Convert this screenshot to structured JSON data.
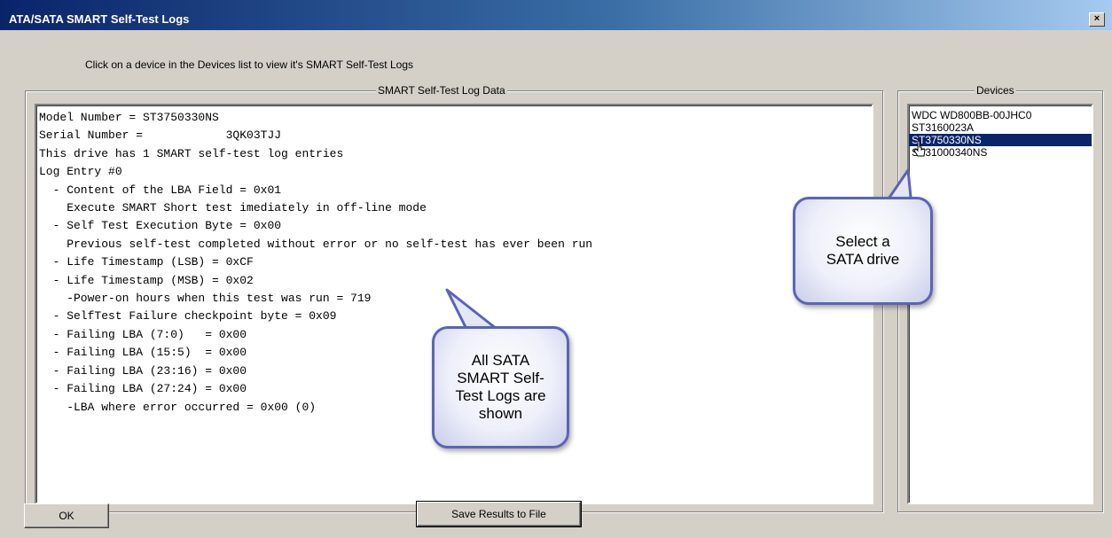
{
  "window": {
    "title": "ATA/SATA SMART Self-Test Logs",
    "close_label": "×"
  },
  "instruction": "Click on a device in the Devices list to view it's SMART Self-Test Logs",
  "log_group": {
    "label": "SMART Self-Test Log Data",
    "lines": [
      "Model Number = ST3750330NS",
      "Serial Number =            3QK03TJJ",
      "This drive has 1 SMART self-test log entries",
      "Log Entry #0",
      "  - Content of the LBA Field = 0x01",
      "    Execute SMART Short test imediately in off-line mode",
      "  - Self Test Execution Byte = 0x00",
      "    Previous self-test completed without error or no self-test has ever been run",
      "  - Life Timestamp (LSB) = 0xCF",
      "  - Life Timestamp (MSB) = 0x02",
      "    -Power-on hours when this test was run = 719",
      "  - SelfTest Failure checkpoint byte = 0x09",
      "  - Failing LBA (7:0)   = 0x00",
      "  - Failing LBA (15:5)  = 0x00",
      "  - Failing LBA (23:16) = 0x00",
      "  - Failing LBA (27:24) = 0x00",
      "    -LBA where error occurred = 0x00 (0)"
    ]
  },
  "devices_group": {
    "label": "Devices",
    "items": [
      {
        "label": "WDC WD800BB-00JHC0",
        "selected": false
      },
      {
        "label": "ST3160023A",
        "selected": false
      },
      {
        "label": "ST3750330NS",
        "selected": true
      },
      {
        "label": "ST31000340NS",
        "selected": false
      }
    ]
  },
  "callouts": {
    "logs": [
      "All SATA",
      "SMART Self-",
      "Test Logs are",
      "shown"
    ],
    "select": [
      "Select a",
      "SATA drive"
    ]
  },
  "buttons": {
    "ok_label": "OK",
    "save_label": "Save Results to File"
  },
  "colors": {
    "selection": "#0a246a",
    "callout_border": "#5b64b5",
    "titlebar": "#0a246a"
  }
}
